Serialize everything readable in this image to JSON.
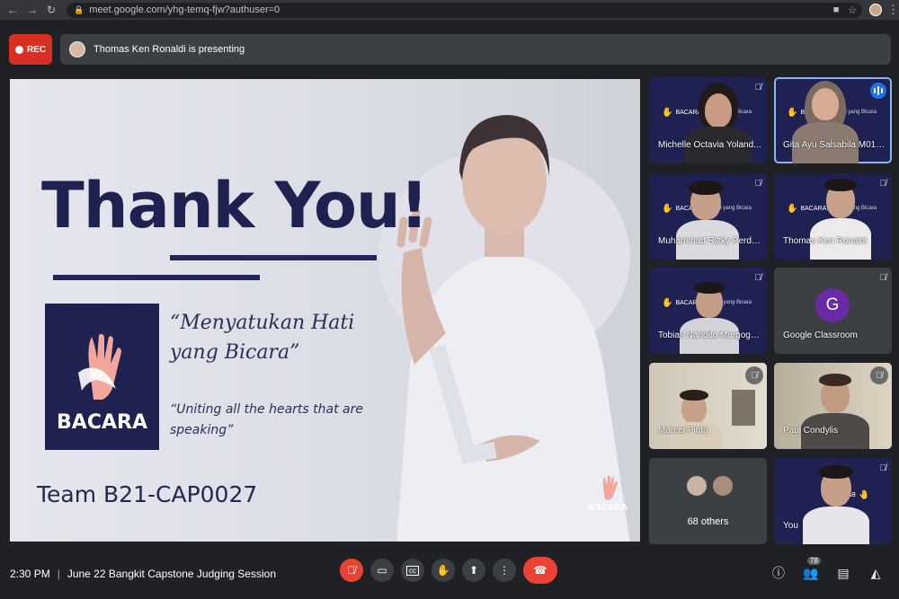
{
  "browser": {
    "url": "meet.google.com/yhg-temq-fjw?authuser=0"
  },
  "topbar": {
    "rec_label": "REC",
    "presenting_text": "Thomas Ken Ronaldi is presenting"
  },
  "slide": {
    "title": "Thank You!",
    "logo_word": "BACARA",
    "quote_main": "“Menyatukan Hati yang Bicara”",
    "quote_sub": "“Uniting all the hearts that are speaking”",
    "team": "Team B21-CAP0027",
    "corner_logo": "BACARA"
  },
  "participants": [
    {
      "name": "Michelle Octavia Yoland...",
      "muted": true,
      "speaking": false
    },
    {
      "name": "Gita Ayu Salsabila M010...",
      "muted": false,
      "speaking": true
    },
    {
      "name": "Muhammad Rizky Perda...",
      "muted": true,
      "speaking": false
    },
    {
      "name": "Thomas Ken Ronaldi",
      "muted": true,
      "speaking": false
    },
    {
      "name": "Tobias Nandito Margogo...",
      "muted": true,
      "speaking": false
    },
    {
      "name": "Google Classroom",
      "muted": true,
      "speaking": false,
      "avatar_letter": "G"
    },
    {
      "name": "Marcel Pinto",
      "muted": true,
      "speaking": false
    },
    {
      "name": "Paul Condylis",
      "muted": true,
      "speaking": false
    },
    {
      "name": "68 others"
    },
    {
      "name": "You",
      "muted": true
    }
  ],
  "tile_slide_text": {
    "brand": "BACARA:",
    "tagline": "Hati yang Bicara"
  },
  "bottombar": {
    "time": "2:30 PM",
    "separator": "|",
    "meeting_title": "June 22 Bangkit Capstone Judging Session",
    "people_count": "78"
  },
  "colors": {
    "rec": "#d93025",
    "end_call": "#ea4335",
    "navy": "#1f2150",
    "active_outline": "#8ab4f8"
  }
}
